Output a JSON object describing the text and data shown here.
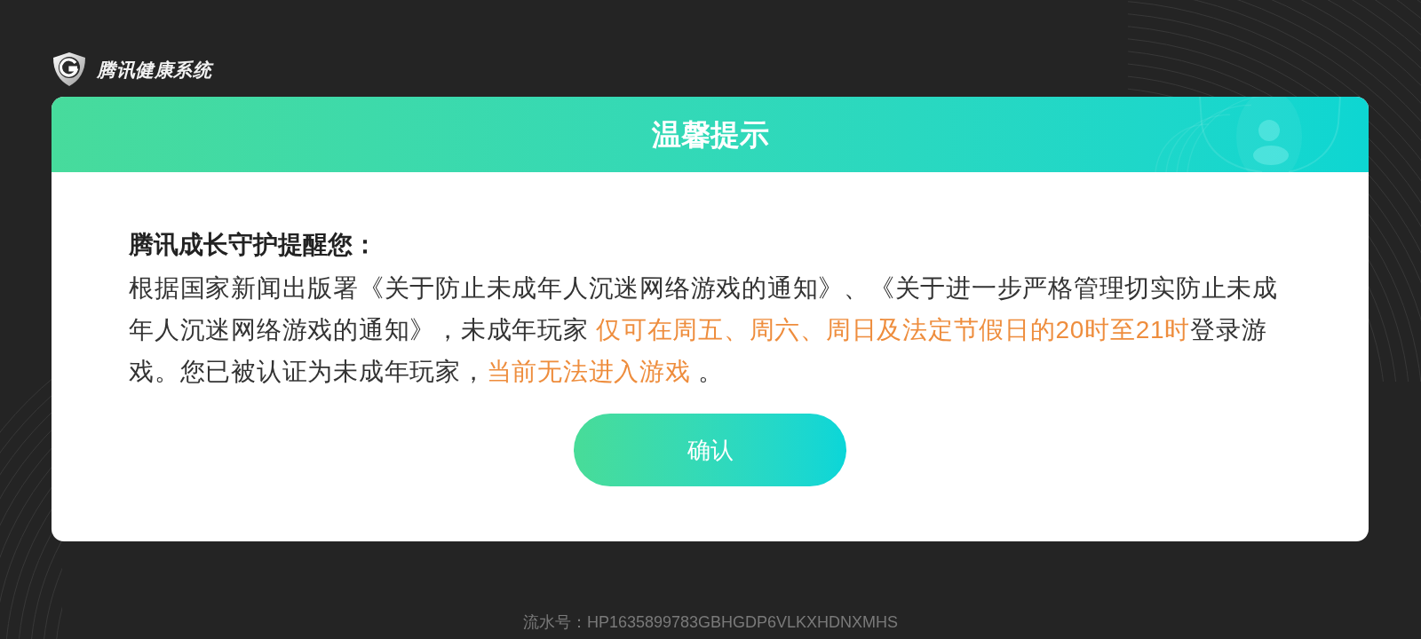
{
  "logo": {
    "text": "腾讯健康系统"
  },
  "dialog": {
    "title": "温馨提示",
    "greeting": "腾讯成长守护提醒您：",
    "message": [
      {
        "text": "根据国家新闻出版署《关于防止未成年人沉迷网络游戏的通知》、《关于进一步严格管理切实防止未成年人沉迷网络游戏的通知》，未成年玩家 ",
        "highlight": false
      },
      {
        "text": "仅可在周五、周六、周日及法定节假日的20时至21时",
        "highlight": true
      },
      {
        "text": "登录游戏。您已被认证为未成年玩家，",
        "highlight": false
      },
      {
        "text": "当前无法进入游戏",
        "highlight": true
      },
      {
        "text": " 。",
        "highlight": false
      }
    ],
    "confirm_button": "确认"
  },
  "footer": {
    "serial": "流水号：HP1635899783GBHGDP6VLKXHDNXMHS"
  }
}
